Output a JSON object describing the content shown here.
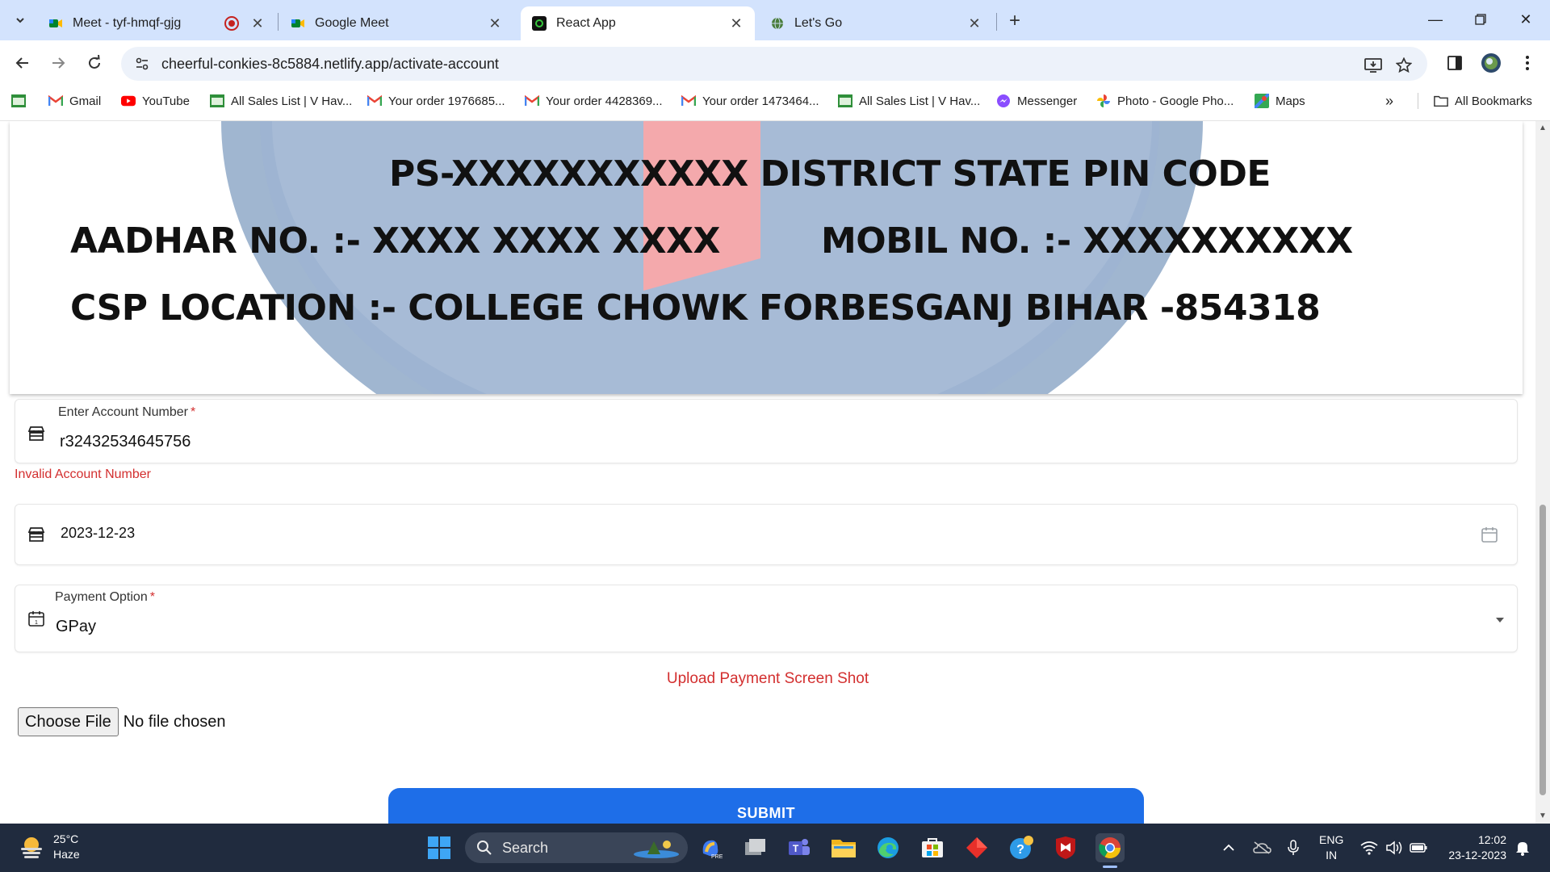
{
  "browser": {
    "tabs": [
      {
        "title": "Meet - tyf-hmqf-gjg",
        "recording": true
      },
      {
        "title": "Google Meet"
      },
      {
        "title": "React App",
        "active": true
      },
      {
        "title": "Let's Go"
      }
    ],
    "url": "cheerful-conkies-8c5884.netlify.app/activate-account",
    "bookmarks": [
      {
        "label": "Gmail",
        "icon": "gmail-icon"
      },
      {
        "label": "YouTube",
        "icon": "youtube-icon"
      },
      {
        "label": "All Sales List | V Hav...",
        "icon": "sheet-icon"
      },
      {
        "label": "Your order 1976685...",
        "icon": "gmail-icon"
      },
      {
        "label": "Your order 4428369...",
        "icon": "gmail-icon"
      },
      {
        "label": "Your order 1473464...",
        "icon": "gmail-icon"
      },
      {
        "label": "All Sales List | V Hav...",
        "icon": "sheet-icon"
      },
      {
        "label": "Messenger",
        "icon": "messenger-icon"
      },
      {
        "label": "Photo - Google Pho...",
        "icon": "photos-icon"
      },
      {
        "label": "Maps",
        "icon": "maps-icon"
      }
    ],
    "all_bookmarks_label": "All Bookmarks"
  },
  "header_image": {
    "line1": "PS-XXXXXXXXXXX  DISTRICT STATE  PIN CODE",
    "line2_left": "AADHAR NO.    :- XXXX XXXX XXXX",
    "line2_right": "MOBIL NO. :- XXXXXXXXXX",
    "line3": "CSP LOCATION :- COLLEGE CHOWK FORBESGANJ BIHAR -854318"
  },
  "form": {
    "account_label": "Enter Account Number",
    "required_mark": "*",
    "account_value": "r32432534645756",
    "account_error": "Invalid Account Number",
    "date_value": "2023-12-23",
    "payment_label": "Payment Option",
    "payment_value": "GPay",
    "upload_title": "Upload Payment Screen Shot",
    "choose_file_label": "Choose File",
    "no_file_text": "No file chosen",
    "submit_label": "SUBMIT"
  },
  "taskbar": {
    "temperature": "25°C",
    "weather": "Haze",
    "search_label": "Search",
    "lang_top": "ENG",
    "lang_bottom": "IN",
    "time": "12:02",
    "date": "23-12-2023"
  },
  "colors": {
    "accent": "#1e6ee8",
    "error": "#d32f2f",
    "tabstrip": "#d3e3fd",
    "taskbar": "#202b3e"
  }
}
